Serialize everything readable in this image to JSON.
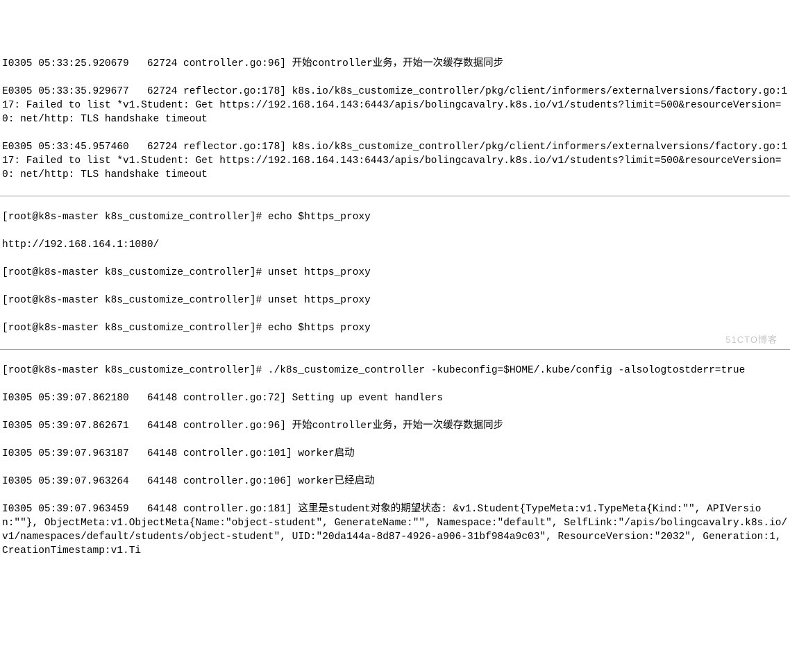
{
  "block1": {
    "l0": "I0305 05:33:25.920679   62724 controller.go:96] 开始controller业务，开始一次缓存数据同步",
    "l1": "E0305 05:33:35.929677   62724 reflector.go:178] k8s.io/k8s_customize_controller/pkg/client/informers/externalversions/factory.go:117: Failed to list *v1.Student: Get https://192.168.164.143:6443/apis/bolingcavalry.k8s.io/v1/students?limit=500&resourceVersion=0: net/http: TLS handshake timeout",
    "l2": "E0305 05:33:45.957460   62724 reflector.go:178] k8s.io/k8s_customize_controller/pkg/client/informers/externalversions/factory.go:117: Failed to list *v1.Student: Get https://192.168.164.143:6443/apis/bolingcavalry.k8s.io/v1/students?limit=500&resourceVersion=0: net/http: TLS handshake timeout"
  },
  "block2": {
    "prompt": "[root@k8s-master k8s_customize_controller]#",
    "cmd0": " echo $https_proxy",
    "out0": "http://192.168.164.1:1080/",
    "cmd1": " unset https_proxy",
    "cmd2": " unset https_proxy",
    "cmd3": " echo $https proxy"
  },
  "block3": {
    "prompt": "[root@k8s-master k8s_customize_controller]#",
    "cmd": " ./k8s_customize_controller -kubeconfig=$HOME/.kube/config -alsologtostderr=true",
    "l0": "I0305 05:39:07.862180   64148 controller.go:72] Setting up event handlers",
    "l1": "I0305 05:39:07.862671   64148 controller.go:96] 开始controller业务，开始一次缓存数据同步",
    "l2": "I0305 05:39:07.963187   64148 controller.go:101] worker启动",
    "l3": "I0305 05:39:07.963264   64148 controller.go:106] worker已经启动",
    "l4": "I0305 05:39:07.963459   64148 controller.go:181] 这里是student对象的期望状态: &v1.Student{TypeMeta:v1.TypeMeta{Kind:\"\", APIVersion:\"\"}, ObjectMeta:v1.ObjectMeta{Name:\"object-student\", GenerateName:\"\", Namespace:\"default\", SelfLink:\"/apis/bolingcavalry.k8s.io/v1/namespaces/default/students/object-student\", UID:\"20da144a-8d87-4926-a906-31bf984a9c03\", ResourceVersion:\"2032\", Generation:1, CreationTimestamp:v1.Ti"
  },
  "watermark": "51CTO博客"
}
